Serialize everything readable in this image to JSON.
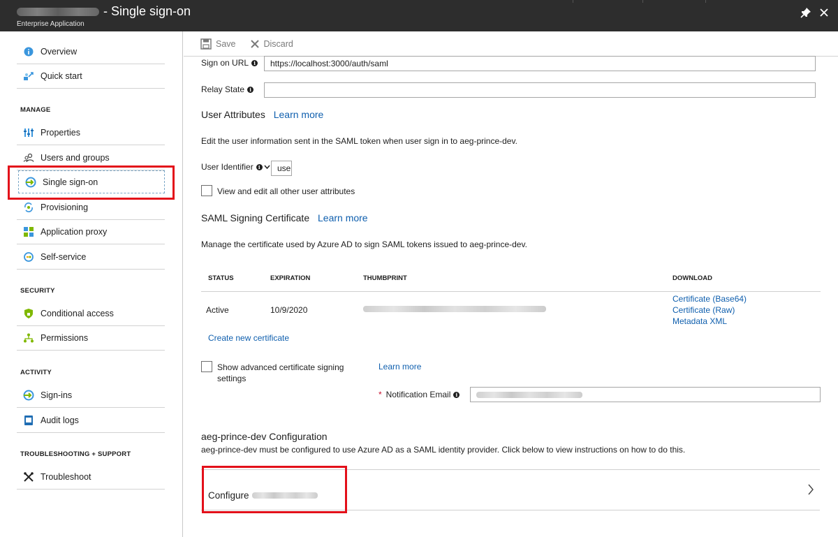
{
  "window": {
    "title": "- Single sign-on",
    "subtitle": "Enterprise Application",
    "pin_icon": "pin-icon",
    "close_icon": "close-icon"
  },
  "sidebar": {
    "top_items": [
      {
        "label": "Overview",
        "icon": "info-circle-icon"
      },
      {
        "label": "Quick start",
        "icon": "rocket-cloud-icon"
      }
    ],
    "sections": [
      {
        "label": "MANAGE",
        "items": [
          {
            "label": "Properties",
            "icon": "sliders-icon"
          },
          {
            "label": "Users and groups",
            "icon": "users-icon"
          },
          {
            "label": "Single sign-on",
            "icon": "sso-icon",
            "selected": true
          },
          {
            "label": "Provisioning",
            "icon": "provisioning-icon"
          },
          {
            "label": "Application proxy",
            "icon": "app-proxy-icon"
          },
          {
            "label": "Self-service",
            "icon": "self-service-icon"
          }
        ]
      },
      {
        "label": "SECURITY",
        "items": [
          {
            "label": "Conditional access",
            "icon": "shield-icon"
          },
          {
            "label": "Permissions",
            "icon": "permissions-tree-icon"
          }
        ]
      },
      {
        "label": "ACTIVITY",
        "items": [
          {
            "label": "Sign-ins",
            "icon": "sign-in-icon"
          },
          {
            "label": "Audit logs",
            "icon": "audit-log-icon"
          }
        ]
      },
      {
        "label": "TROUBLESHOOTING + SUPPORT",
        "items": [
          {
            "label": "Troubleshoot",
            "icon": "wrench-icon"
          }
        ]
      }
    ]
  },
  "toolbar": {
    "save_label": "Save",
    "discard_label": "Discard"
  },
  "form": {
    "sign_on_url_label": "Sign on URL",
    "sign_on_url_value": "https://localhost:3000/auth/saml",
    "relay_state_label": "Relay State",
    "relay_state_value": ""
  },
  "user_attributes": {
    "heading": "User Attributes",
    "learn_more": "Learn more",
    "description": "Edit the user information sent in the SAML token when user sign in to aeg-prince-dev.",
    "identifier_label": "User Identifier",
    "identifier_value": "user",
    "view_edit_label": "View and edit all other user attributes"
  },
  "saml_cert": {
    "heading": "SAML Signing Certificate",
    "learn_more": "Learn more",
    "description": "Manage the certificate used by Azure AD to sign SAML tokens issued to aeg-prince-dev.",
    "columns": [
      "STATUS",
      "EXPIRATION",
      "THUMBPRINT",
      "DOWNLOAD"
    ],
    "row": {
      "status": "Active",
      "expiration": "10/9/2020",
      "downloads": [
        "Certificate (Base64)",
        "Certificate (Raw)",
        "Metadata XML"
      ]
    },
    "create_new": "Create new certificate",
    "advanced_label_line1": "Show advanced certificate signing",
    "advanced_label_line2": "settings",
    "advanced_learn_more": "Learn more",
    "notification_email_label": "Notification Email",
    "required_marker": "*"
  },
  "configuration": {
    "heading": "aeg-prince-dev Configuration",
    "description": "aeg-prince-dev must be configured to use Azure AD as a SAML identity provider. Click below to view instructions on how to do this.",
    "configure_label": "Configure"
  },
  "colors": {
    "title_bar": "#2d2d2d",
    "link": "#0f5fae",
    "highlight": "#e3101a"
  }
}
